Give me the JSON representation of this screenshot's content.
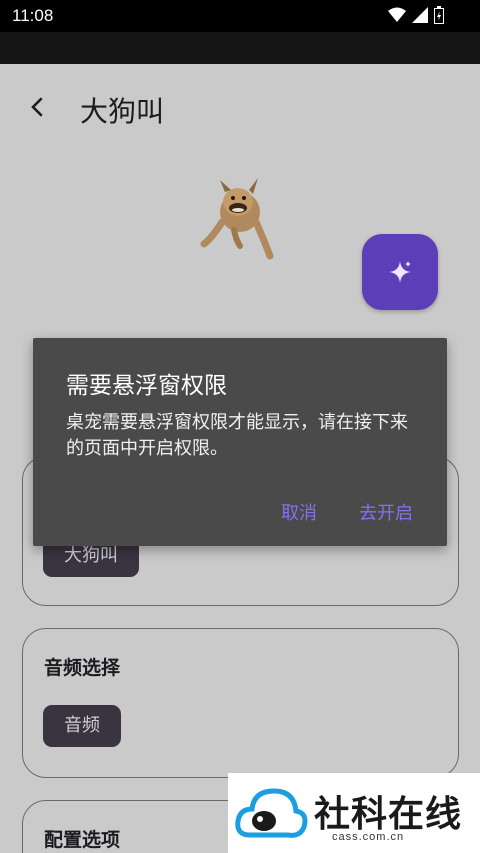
{
  "status_bar": {
    "time": "11:08"
  },
  "header": {
    "title": "大狗叫"
  },
  "cards": [
    {
      "title": "",
      "chip_label": "大狗叫"
    },
    {
      "title": "音频选择",
      "chip_label": "音频"
    },
    {
      "title": "配置选项"
    }
  ],
  "dialog": {
    "title": "需要悬浮窗权限",
    "message": "桌宠需要悬浮窗权限才能显示，请在接下来的页面中开启权限。",
    "cancel_label": "取消",
    "confirm_label": "去开启"
  },
  "watermark": {
    "text": "社科在线",
    "url": "cass.com.cn"
  },
  "colors": {
    "accent": "#8a6ef0",
    "fab": "#5d3eb8",
    "dialog_bg": "#4a4a4a"
  }
}
